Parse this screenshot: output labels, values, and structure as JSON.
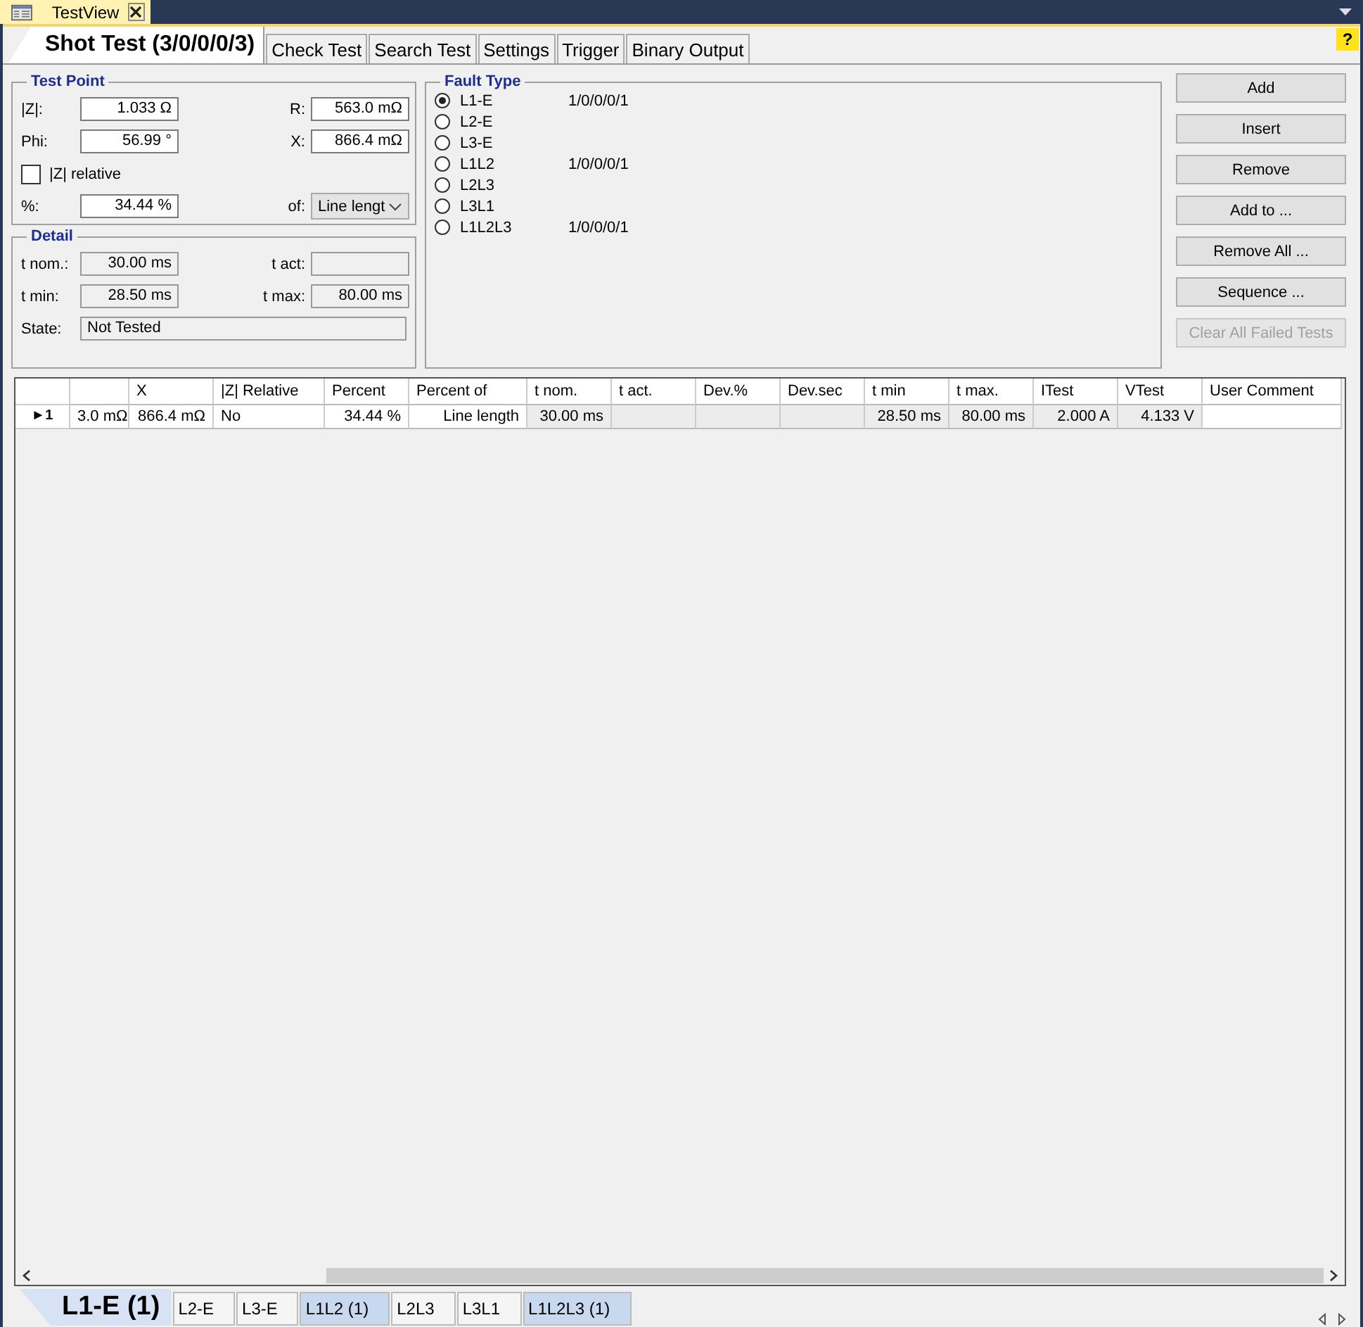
{
  "window": {
    "title": "TestView"
  },
  "tabs": [
    {
      "label": "Shot Test (3/0/0/0/3)",
      "selected": true
    },
    {
      "label": "Check Test",
      "selected": false
    },
    {
      "label": "Search Test",
      "selected": false
    },
    {
      "label": "Settings",
      "selected": false
    },
    {
      "label": "Trigger",
      "selected": false
    },
    {
      "label": "Binary Output",
      "selected": false
    }
  ],
  "help": {
    "label": "?"
  },
  "test_point": {
    "title": "Test Point",
    "z_label": "|Z|:",
    "z": "1.033 Ω",
    "r_label": "R:",
    "r": "563.0 mΩ",
    "phi_label": "Phi:",
    "phi": "56.99 °",
    "x_label": "X:",
    "x": "866.4 mΩ",
    "relative_label": "|Z| relative",
    "relative_checked": false,
    "percent_label": "%:",
    "percent": "34.44 %",
    "of_label": "of:",
    "of": "Line lengt"
  },
  "detail": {
    "title": "Detail",
    "t_nom_label": "t nom.:",
    "t_nom": "30.00 ms",
    "t_act_label": "t act:",
    "t_min_label": "t min:",
    "t_min": "28.50 ms",
    "t_max_label": "t max:",
    "t_max": "80.00 ms",
    "state_label": "State:",
    "state": "Not Tested"
  },
  "fault_type": {
    "title": "Fault Type",
    "items": [
      {
        "label": "L1-E",
        "selected": true,
        "count": "1/0/0/0/1"
      },
      {
        "label": "L2-E",
        "selected": false
      },
      {
        "label": "L3-E",
        "selected": false
      },
      {
        "label": "L1L2",
        "selected": false,
        "count": "1/0/0/0/1"
      },
      {
        "label": "L2L3",
        "selected": false
      },
      {
        "label": "L3L1",
        "selected": false
      },
      {
        "label": "L1L2L3",
        "selected": false,
        "count": "1/0/0/0/1"
      }
    ]
  },
  "buttons": [
    {
      "label": "Add",
      "disabled": false
    },
    {
      "label": "Insert",
      "disabled": false
    },
    {
      "label": "Remove",
      "disabled": false
    },
    {
      "label": "Add to ...",
      "disabled": false
    },
    {
      "label": "Remove All ...",
      "disabled": false
    },
    {
      "label": "Sequence ...",
      "disabled": false
    },
    {
      "label": "Clear All Failed Tests",
      "disabled": true
    }
  ],
  "table": {
    "columns": [
      {
        "editable": true
      },
      {
        "label": "X",
        "editable": true
      },
      {
        "label": "|Z| Relative",
        "editable": true
      },
      {
        "label": "Percent",
        "editable": true
      },
      {
        "label": "Percent of",
        "editable": true
      },
      {
        "label": "t nom.",
        "editable": false
      },
      {
        "label": "t act.",
        "editable": false
      },
      {
        "label": "Dev.%",
        "editable": false
      },
      {
        "label": "Dev.sec",
        "editable": false
      },
      {
        "label": "t min",
        "editable": false
      },
      {
        "label": "t max.",
        "editable": false
      },
      {
        "label": "ITest",
        "editable": false
      },
      {
        "label": "VTest",
        "editable": false
      },
      {
        "label": "User Comment",
        "editable": true
      }
    ],
    "rows": [
      {
        "marker": "►1",
        "cells": [
          "3.0 mΩ",
          "866.4 mΩ",
          "No",
          "34.44 %",
          "Line length",
          "30.00 ms",
          null,
          null,
          null,
          "28.50 ms",
          "80.00 ms",
          "2.000 A",
          "4.133 V",
          null
        ]
      }
    ]
  },
  "fault_tabs": [
    {
      "label": "L1-E (1)",
      "selected": true,
      "has_tests": true
    },
    {
      "label": "L2-E",
      "selected": false,
      "has_tests": false
    },
    {
      "label": "L3-E",
      "selected": false,
      "has_tests": false
    },
    {
      "label": "L1L2 (1)",
      "selected": false,
      "has_tests": true
    },
    {
      "label": "L2L3",
      "selected": false,
      "has_tests": false
    },
    {
      "label": "L3L1",
      "selected": false,
      "has_tests": false
    },
    {
      "label": "L1L2L3 (1)",
      "selected": false,
      "has_tests": true
    }
  ]
}
